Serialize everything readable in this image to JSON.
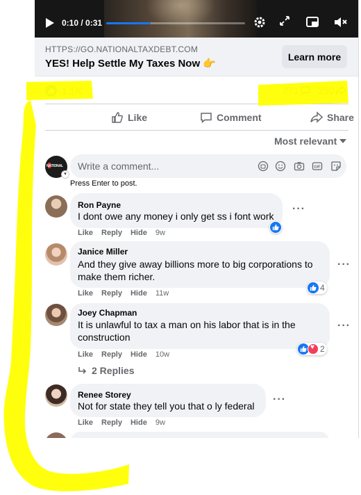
{
  "video": {
    "time": "0:10 / 0:31",
    "progress": 0.32
  },
  "link": {
    "domain": "HTTPS://GO.NATIONALTAXDEBT.COM",
    "title": "YES! Help Settle My Taxes Now",
    "emoji": "👉",
    "cta": "Learn more"
  },
  "stats": {
    "reactions": "1.1K",
    "comments": "271",
    "shares": "250"
  },
  "actions": {
    "like": "Like",
    "comment": "Comment",
    "share": "Share"
  },
  "sort": "Most relevant",
  "composer": {
    "avatar_text": "NATIONAL",
    "placeholder": "Write a comment...",
    "hint": "Press Enter to post."
  },
  "comment_actions": {
    "like": "Like",
    "reply": "Reply",
    "hide": "Hide"
  },
  "comments": [
    {
      "name": "Ron Payne",
      "lines": [
        "I dont owe any money i only get ss i font work"
      ],
      "time": "9w",
      "reactions": ""
    },
    {
      "name": "Janice Miller",
      "lines": [
        "And they give away billions more to big corporations to",
        "make them richer."
      ],
      "time": "11w",
      "reactions": "4"
    },
    {
      "name": "Joey Chapman",
      "lines": [
        "It is unlawful to tax a man on his labor that is in the",
        "construction"
      ],
      "time": "10w",
      "reactions": "2",
      "replies": "2 Replies"
    },
    {
      "name": "Renee Storey",
      "lines": [
        "Not for state they tell you that o ly federal"
      ],
      "time": "9w",
      "reactions": ""
    }
  ],
  "colors": {
    "highlight": "#ffff00",
    "brand_blue": "#1877f2",
    "love_red": "#f33e58"
  }
}
